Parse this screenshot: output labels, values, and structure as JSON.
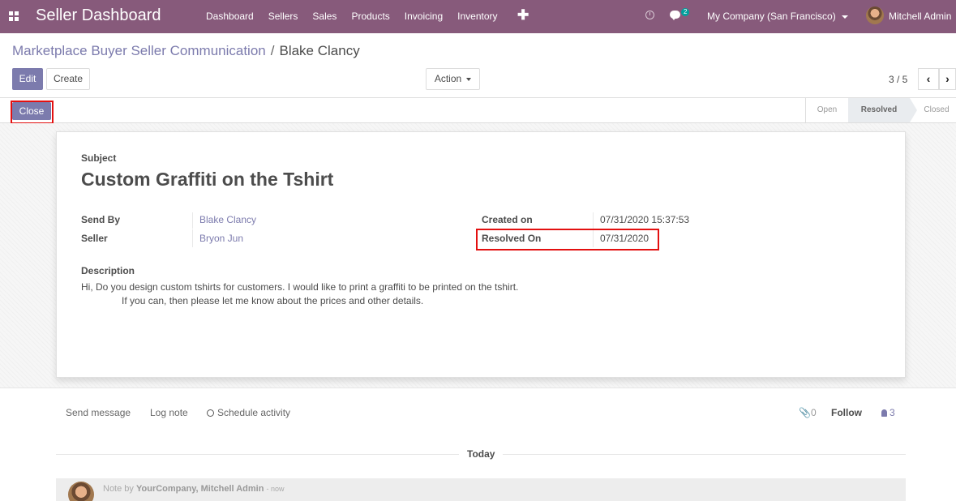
{
  "navbar": {
    "brand": "Seller Dashboard",
    "menu": [
      "Dashboard",
      "Sellers",
      "Sales",
      "Products",
      "Invoicing",
      "Inventory"
    ],
    "chat_count": "2",
    "company": "My Company (San Francisco)",
    "user": "Mitchell Admin"
  },
  "breadcrumb": {
    "parent": "Marketplace Buyer Seller Communication",
    "separator": "/",
    "current": "Blake Clancy"
  },
  "control": {
    "edit_label": "Edit",
    "create_label": "Create",
    "action_label": "Action",
    "pager_value": "3 / 5"
  },
  "statusbar": {
    "close_label": "Close",
    "stages": [
      "Open",
      "Resolved",
      "Closed"
    ],
    "active_stage": "Resolved"
  },
  "form": {
    "subject_label": "Subject",
    "subject": "Custom Graffiti on the Tshirt",
    "send_by_label": "Send By",
    "send_by": "Blake Clancy",
    "seller_label": "Seller",
    "seller": "Bryon Jun",
    "created_on_label": "Created on",
    "created_on": "07/31/2020 15:37:53",
    "resolved_on_label": "Resolved On",
    "resolved_on": "07/31/2020",
    "description_label": "Description",
    "description": "Hi, Do you design custom tshirts for customers. I would like to print a graffiti to be printed on the tshirt.\n               If you can, then please let me know about the prices and other details."
  },
  "chatter": {
    "send_message": "Send message",
    "log_note": "Log note",
    "schedule_activity": "Schedule activity",
    "attachments_count": "0",
    "follow": "Follow",
    "followers_count": "3",
    "today": "Today",
    "note_prefix": "Note by",
    "note_author": "YourCompany, Mitchell Admin",
    "note_time": "- now"
  },
  "colors": {
    "navbar": "#875a7b",
    "primary": "#7c7bad",
    "highlight": "#e31010"
  }
}
